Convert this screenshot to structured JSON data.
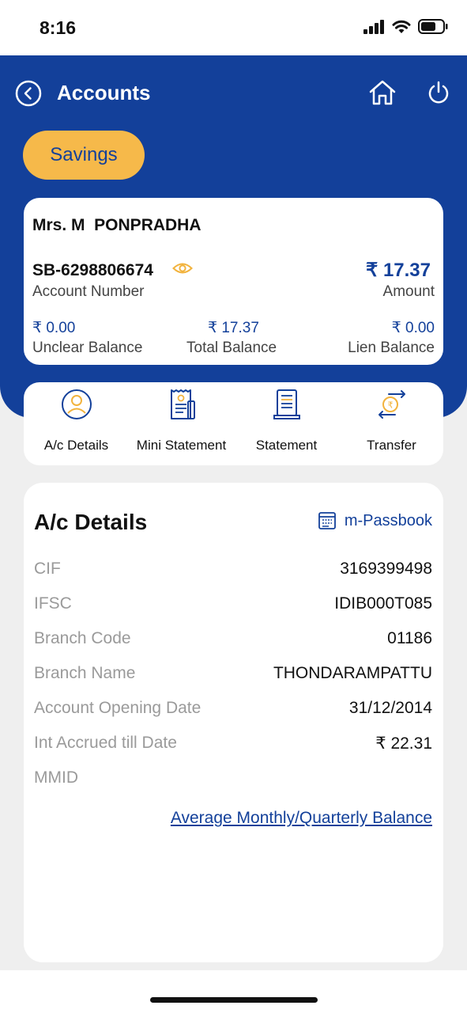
{
  "status_bar": {
    "time": "8:16"
  },
  "header": {
    "title": "Accounts"
  },
  "account_type_tab": "Savings",
  "account_card": {
    "holder_name": "Mrs. M  PONPRADHA",
    "account_number": "SB-6298806674",
    "account_number_label": "Account Number",
    "amount": "₹ 17.37",
    "amount_label": "Amount",
    "balances": [
      {
        "value": "₹ 0.00",
        "label": "Unclear Balance"
      },
      {
        "value": "₹ 17.37",
        "label": "Total Balance"
      },
      {
        "value": "₹ 0.00",
        "label": "Lien Balance"
      }
    ]
  },
  "actions": [
    {
      "label": "A/c Details",
      "icon": "user-circle-icon"
    },
    {
      "label": "Mini Statement",
      "icon": "receipt-icon"
    },
    {
      "label": "Statement",
      "icon": "document-icon"
    },
    {
      "label": "Transfer",
      "icon": "transfer-icon"
    }
  ],
  "details": {
    "title": "A/c Details",
    "passbook_label": "m-Passbook",
    "rows": [
      {
        "label": "CIF",
        "value": "3169399498"
      },
      {
        "label": "IFSC",
        "value": "IDIB000T085"
      },
      {
        "label": "Branch Code",
        "value": "01186"
      },
      {
        "label": "Branch Name",
        "value": "THONDARAMPATTU"
      },
      {
        "label": "Account Opening Date",
        "value": "31/12/2014"
      },
      {
        "label": "Int Accrued till Date",
        "value": "₹ 22.31"
      },
      {
        "label": "MMID",
        "value": ""
      }
    ],
    "avg_balance_link": "Average Monthly/Quarterly Balance"
  },
  "colors": {
    "brand_blue": "#13409a",
    "accent_yellow": "#f6b94a",
    "icon_gold": "#f2b33d"
  }
}
